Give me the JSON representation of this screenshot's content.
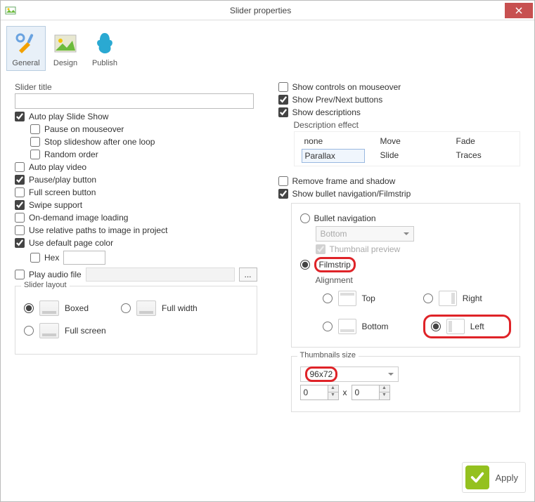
{
  "window": {
    "title": "Slider properties"
  },
  "tabs": {
    "general": "General",
    "design": "Design",
    "publish": "Publish"
  },
  "left": {
    "slider_title_label": "Slider title",
    "slider_title_value": "",
    "autoplay": "Auto play Slide Show",
    "pause_mouseover": "Pause on mouseover",
    "stop_after_loop": "Stop slideshow after one loop",
    "random_order": "Random order",
    "autoplay_video": "Auto play video",
    "pauseplay_btn": "Pause/play button",
    "fullscreen_btn": "Full screen button",
    "swipe": "Swipe support",
    "ondemand": "On-demand image loading",
    "relpaths": "Use relative paths to image in project",
    "defcolor": "Use default page color",
    "hex_label": "Hex",
    "hex_value": "",
    "play_audio": "Play audio file",
    "audio_value": "",
    "audio_browse": "...",
    "layout": {
      "title": "Slider layout",
      "boxed": "Boxed",
      "fullwidth": "Full width",
      "fullscreen": "Full screen"
    }
  },
  "right": {
    "show_controls": "Show controls on mouseover",
    "show_prevnext": "Show Prev/Next buttons",
    "show_desc": "Show descriptions",
    "desc_effect_label": "Description effect",
    "desc_effects": {
      "none": "none",
      "move": "Move",
      "fade": "Fade",
      "parallax": "Parallax",
      "slide": "Slide",
      "traces": "Traces"
    },
    "remove_frame": "Remove frame and shadow",
    "show_bullet": "Show bullet navigation/Filmstrip",
    "nav": {
      "bullet": "Bullet navigation",
      "bullet_pos": "Bottom",
      "thumb_preview": "Thumbnail preview",
      "filmstrip": "Filmstrip",
      "alignment": "Alignment",
      "top": "Top",
      "right": "Right",
      "bottom": "Bottom",
      "left": "Left"
    },
    "thumbs": {
      "title": "Thumbnails size",
      "selected": "96x72",
      "w": "0",
      "h": "0",
      "x": "x"
    }
  },
  "apply": "Apply"
}
